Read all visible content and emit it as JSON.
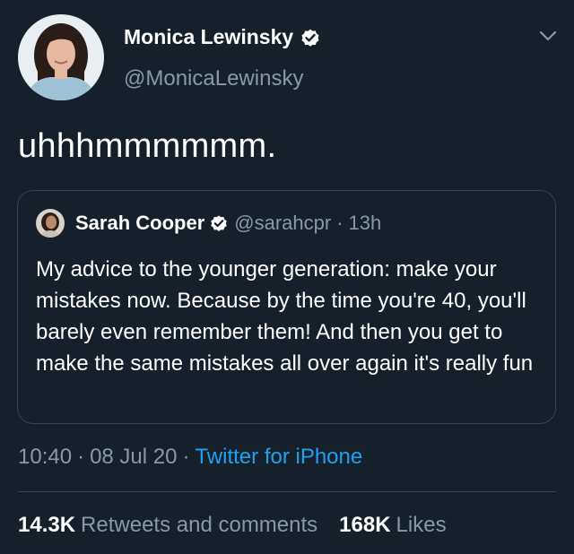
{
  "tweet": {
    "author": {
      "name": "Monica Lewinsky",
      "handle": "@MonicaLewinsky",
      "avatar_icon": "profile-photo",
      "verified_icon": "verified-badge-icon"
    },
    "menu_icon": "chevron-down-icon",
    "text": "uhhhmmmmmm.",
    "quote": {
      "author_name": "Sarah Cooper",
      "handle": "@sarahcpr",
      "separator": "·",
      "time": "13h",
      "body": "My advice to the younger generation: make your mistakes now. Because by the time you're 40, you'll barely even remember them! And then you get to make the same mistakes all over again it's really fun"
    },
    "meta": {
      "time": "10:40",
      "separator": "·",
      "date": "08 Jul 20",
      "source": "Twitter for iPhone"
    },
    "stats": {
      "retweets_count": "14.3K",
      "retweets_label": "Retweets and comments",
      "likes_count": "168K",
      "likes_label": "Likes"
    }
  },
  "colors": {
    "background": "#15202b",
    "text_primary": "#ffffff",
    "text_secondary": "#8899a6",
    "accent": "#1da1f2",
    "border": "#38444d"
  }
}
